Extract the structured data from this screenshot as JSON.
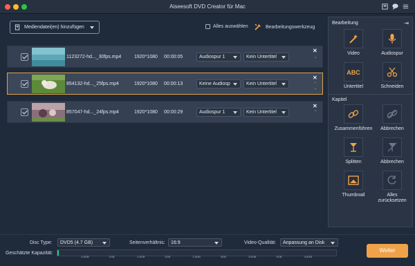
{
  "window": {
    "title": "Aiseesoft DVD Creator für Mac"
  },
  "toolbar": {
    "add_label": "Mediendatei(en) hinzufügen",
    "select_all_label": "Alles auswählen",
    "edit_tool_label": "Bearbeitungswerkzeug"
  },
  "files": [
    {
      "name": "1123272-hd..._30fps.mp4",
      "resolution": "1920*1080",
      "duration": "00:00:05",
      "audio": "Audiospur 1",
      "subtitle": "Kein Untertitel",
      "selected": false
    },
    {
      "name": "854132-hd..._25fps.mp4",
      "resolution": "1920*1080",
      "duration": "00:00:13",
      "audio": "Keine Audiosp",
      "subtitle": "Kein Untertitel",
      "selected": true
    },
    {
      "name": "857047-hd..._24fps.mp4",
      "resolution": "1920*1080",
      "duration": "00:00:29",
      "audio": "Audiospur 1",
      "subtitle": "Kein Untertitel",
      "selected": false
    }
  ],
  "panel": {
    "edit_heading": "Bearbeitung",
    "chapter_heading": "Kapitel",
    "tools": {
      "video": "Video",
      "audio": "Audiospur",
      "subtitle": "Untertitel",
      "cut": "Schneiden",
      "merge": "Zusammenführen",
      "cancel_merge": "Abbrechen",
      "split": "Splitten",
      "cancel_split": "Abbrechen",
      "thumbnail": "Thumbnail",
      "reset": "Alles zurücksetzen"
    }
  },
  "bottom": {
    "disc_type_label": "Disc Type:",
    "disc_type_value": "DVD5 (4.7 GB)",
    "aspect_label": "Seitenverhältnis:",
    "aspect_value": "16:9",
    "quality_label": "Video-Qualität:",
    "quality_value": "Anpassung an Disk",
    "capacity_label": "Geschätzte Kapazität:",
    "capacity_used_fraction": 0.005,
    "capacity_ticks": [
      "0.5GB",
      "1GB",
      "1.5GB",
      "2GB",
      "2.5GB",
      "3GB",
      "3.5GB",
      "4GB",
      "4.5GB"
    ],
    "next_label": "Weiter"
  },
  "colors": {
    "accent": "#f0a24a",
    "capacity": "#2cc985",
    "selection": "#e0a44a"
  }
}
